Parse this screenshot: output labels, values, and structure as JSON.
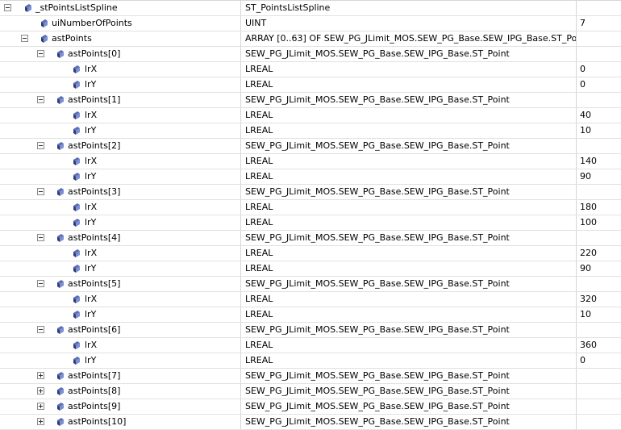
{
  "rows": [
    {
      "level": 0,
      "toggle": "minus",
      "name": "_stPointsListSpline",
      "type": "ST_PointsListSpline",
      "value": ""
    },
    {
      "level": 1,
      "toggle": "",
      "name": "uiNumberOfPoints",
      "type": "UINT",
      "value": "7"
    },
    {
      "level": 1,
      "toggle": "minus",
      "name": "astPoints",
      "type": "ARRAY [0..63] OF SEW_PG_JLimit_MOS.SEW_PG_Base.SEW_IPG_Base.ST_Point",
      "value": ""
    },
    {
      "level": 2,
      "toggle": "minus",
      "name": "astPoints[0]",
      "type": "SEW_PG_JLimit_MOS.SEW_PG_Base.SEW_IPG_Base.ST_Point",
      "value": ""
    },
    {
      "level": 3,
      "toggle": "",
      "name": "lrX",
      "type": "LREAL",
      "value": "0"
    },
    {
      "level": 3,
      "toggle": "",
      "name": "lrY",
      "type": "LREAL",
      "value": "0"
    },
    {
      "level": 2,
      "toggle": "minus",
      "name": "astPoints[1]",
      "type": "SEW_PG_JLimit_MOS.SEW_PG_Base.SEW_IPG_Base.ST_Point",
      "value": ""
    },
    {
      "level": 3,
      "toggle": "",
      "name": "lrX",
      "type": "LREAL",
      "value": "40"
    },
    {
      "level": 3,
      "toggle": "",
      "name": "lrY",
      "type": "LREAL",
      "value": "10"
    },
    {
      "level": 2,
      "toggle": "minus",
      "name": "astPoints[2]",
      "type": "SEW_PG_JLimit_MOS.SEW_PG_Base.SEW_IPG_Base.ST_Point",
      "value": ""
    },
    {
      "level": 3,
      "toggle": "",
      "name": "lrX",
      "type": "LREAL",
      "value": "140"
    },
    {
      "level": 3,
      "toggle": "",
      "name": "lrY",
      "type": "LREAL",
      "value": "90"
    },
    {
      "level": 2,
      "toggle": "minus",
      "name": "astPoints[3]",
      "type": "SEW_PG_JLimit_MOS.SEW_PG_Base.SEW_IPG_Base.ST_Point",
      "value": ""
    },
    {
      "level": 3,
      "toggle": "",
      "name": "lrX",
      "type": "LREAL",
      "value": "180"
    },
    {
      "level": 3,
      "toggle": "",
      "name": "lrY",
      "type": "LREAL",
      "value": "100"
    },
    {
      "level": 2,
      "toggle": "minus",
      "name": "astPoints[4]",
      "type": "SEW_PG_JLimit_MOS.SEW_PG_Base.SEW_IPG_Base.ST_Point",
      "value": ""
    },
    {
      "level": 3,
      "toggle": "",
      "name": "lrX",
      "type": "LREAL",
      "value": "220"
    },
    {
      "level": 3,
      "toggle": "",
      "name": "lrY",
      "type": "LREAL",
      "value": "90"
    },
    {
      "level": 2,
      "toggle": "minus",
      "name": "astPoints[5]",
      "type": "SEW_PG_JLimit_MOS.SEW_PG_Base.SEW_IPG_Base.ST_Point",
      "value": ""
    },
    {
      "level": 3,
      "toggle": "",
      "name": "lrX",
      "type": "LREAL",
      "value": "320"
    },
    {
      "level": 3,
      "toggle": "",
      "name": "lrY",
      "type": "LREAL",
      "value": "10"
    },
    {
      "level": 2,
      "toggle": "minus",
      "name": "astPoints[6]",
      "type": "SEW_PG_JLimit_MOS.SEW_PG_Base.SEW_IPG_Base.ST_Point",
      "value": ""
    },
    {
      "level": 3,
      "toggle": "",
      "name": "lrX",
      "type": "LREAL",
      "value": "360"
    },
    {
      "level": 3,
      "toggle": "",
      "name": "lrY",
      "type": "LREAL",
      "value": "0"
    },
    {
      "level": 2,
      "toggle": "plus",
      "name": "astPoints[7]",
      "type": "SEW_PG_JLimit_MOS.SEW_PG_Base.SEW_IPG_Base.ST_Point",
      "value": ""
    },
    {
      "level": 2,
      "toggle": "plus",
      "name": "astPoints[8]",
      "type": "SEW_PG_JLimit_MOS.SEW_PG_Base.SEW_IPG_Base.ST_Point",
      "value": ""
    },
    {
      "level": 2,
      "toggle": "plus",
      "name": "astPoints[9]",
      "type": "SEW_PG_JLimit_MOS.SEW_PG_Base.SEW_IPG_Base.ST_Point",
      "value": ""
    },
    {
      "level": 2,
      "toggle": "plus",
      "name": "astPoints[10]",
      "type": "SEW_PG_JLimit_MOS.SEW_PG_Base.SEW_IPG_Base.ST_Point",
      "value": ""
    }
  ],
  "icon": "variable-icon",
  "colors": {
    "icon_fill": "#5b6fb8",
    "icon_dark": "#2e3c7a",
    "grid_line": "#e1e1e1",
    "column_line": "#d6d6d6"
  }
}
